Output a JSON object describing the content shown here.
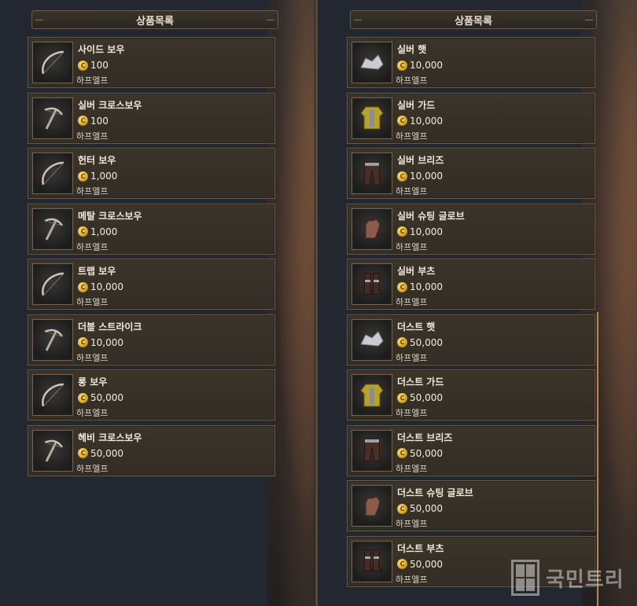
{
  "left_panel": {
    "title": "상품목록",
    "items": [
      {
        "name": "사이드 보우",
        "price": "100",
        "seller": "하프엘프",
        "icon": "bow-icon"
      },
      {
        "name": "실버 크로스보우",
        "price": "100",
        "seller": "하프엘프",
        "icon": "crossbow-icon"
      },
      {
        "name": "헌터 보우",
        "price": "1,000",
        "seller": "하프엘프",
        "icon": "bow-icon"
      },
      {
        "name": "메탈 크로스보우",
        "price": "1,000",
        "seller": "하프엘프",
        "icon": "crossbow-icon"
      },
      {
        "name": "트랩 보우",
        "price": "10,000",
        "seller": "하프엘프",
        "icon": "bow-icon"
      },
      {
        "name": "더블 스트라이크",
        "price": "10,000",
        "seller": "하프엘프",
        "icon": "crossbow-icon"
      },
      {
        "name": "롱 보우",
        "price": "50,000",
        "seller": "하프엘프",
        "icon": "bow-icon"
      },
      {
        "name": "헤비 크로스보우",
        "price": "50,000",
        "seller": "하프엘프",
        "icon": "crossbow-icon"
      }
    ]
  },
  "right_panel": {
    "title": "상품목록",
    "items": [
      {
        "name": "실버 햇",
        "price": "10,000",
        "seller": "하프엘프",
        "icon": "hat-icon"
      },
      {
        "name": "실버 가드",
        "price": "10,000",
        "seller": "하프엘프",
        "icon": "armor-icon"
      },
      {
        "name": "실버 브리즈",
        "price": "10,000",
        "seller": "하프엘프",
        "icon": "pants-icon"
      },
      {
        "name": "실버 슈팅 글로브",
        "price": "10,000",
        "seller": "하프엘프",
        "icon": "glove-icon"
      },
      {
        "name": "실버 부츠",
        "price": "10,000",
        "seller": "하프엘프",
        "icon": "boots-icon"
      },
      {
        "name": "더스트 햇",
        "price": "50,000",
        "seller": "하프엘프",
        "icon": "hat-icon"
      },
      {
        "name": "더스트 가드",
        "price": "50,000",
        "seller": "하프엘프",
        "icon": "armor-icon"
      },
      {
        "name": "더스트 브리즈",
        "price": "50,000",
        "seller": "하프엘프",
        "icon": "pants-icon"
      },
      {
        "name": "더스트 슈팅 글로브",
        "price": "50,000",
        "seller": "하프엘프",
        "icon": "glove-icon"
      },
      {
        "name": "더스트 부츠",
        "price": "50,000",
        "seller": "하프엘프",
        "icon": "boots-icon"
      }
    ]
  },
  "currency_symbol": "C",
  "watermark": {
    "text": "국민트리"
  },
  "colors": {
    "accent": "#b58a4e",
    "coin": "#d9a420",
    "panel": "#232830",
    "card": "#362f27"
  }
}
